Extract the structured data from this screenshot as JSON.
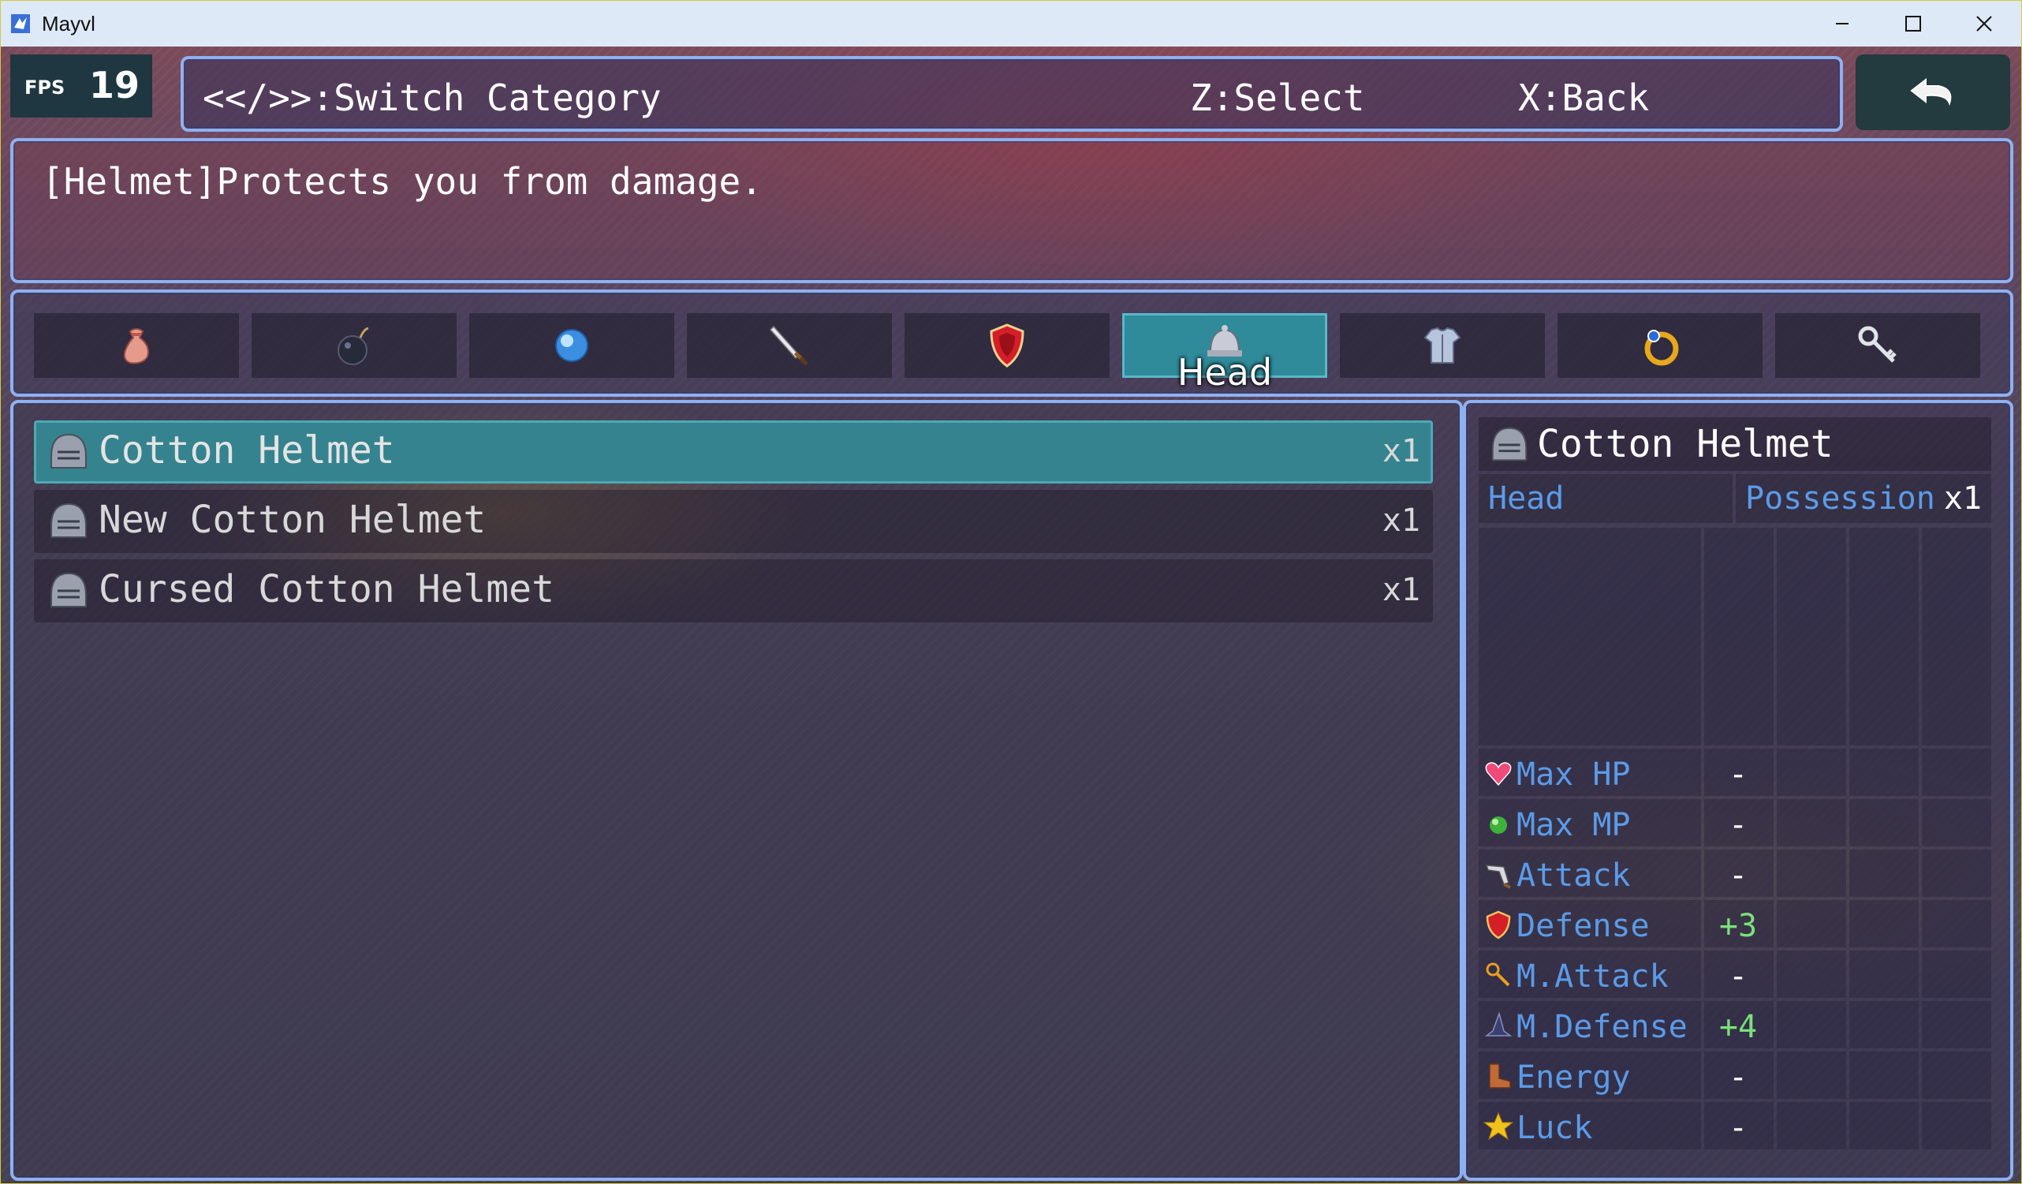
{
  "window": {
    "title": "Mayvl"
  },
  "fps": {
    "label": "FPS",
    "value": "19"
  },
  "help": {
    "switch": "<</>>:Switch Category",
    "select": "Z:Select",
    "back": "X:Back"
  },
  "description": "[Helmet]Protects you from damage.",
  "categories": [
    {
      "icon": "potion-bag-icon"
    },
    {
      "icon": "bomb-icon"
    },
    {
      "icon": "orb-icon"
    },
    {
      "icon": "sword-icon"
    },
    {
      "icon": "shield-icon"
    },
    {
      "icon": "helmet-icon",
      "label": "Head",
      "selected": true
    },
    {
      "icon": "armor-icon"
    },
    {
      "icon": "ring-icon"
    },
    {
      "icon": "key-icon"
    }
  ],
  "items": [
    {
      "name": "Cotton Helmet",
      "qty": "x1",
      "selected": true
    },
    {
      "name": "New Cotton Helmet",
      "qty": "x1"
    },
    {
      "name": "Cursed Cotton Helmet",
      "qty": "x1"
    }
  ],
  "detail": {
    "name": "Cotton Helmet",
    "slot": "Head",
    "possession_label": "Possession",
    "possession_value": "x1",
    "stats": [
      {
        "name": "Max HP",
        "icon": "heart-icon",
        "value": "-"
      },
      {
        "name": "Max MP",
        "icon": "green-orb-icon",
        "value": "-"
      },
      {
        "name": "Attack",
        "icon": "attack-icon",
        "value": "-"
      },
      {
        "name": "Defense",
        "icon": "defense-icon",
        "value": "+3"
      },
      {
        "name": "M.Attack",
        "icon": "wand-icon",
        "value": "-"
      },
      {
        "name": "M.Defense",
        "icon": "witch-hat-icon",
        "value": "+4"
      },
      {
        "name": "Energy",
        "icon": "boots-icon",
        "value": "-"
      },
      {
        "name": "Luck",
        "icon": "star-icon",
        "value": "-"
      }
    ]
  },
  "colors": {
    "highlight": "#35838f",
    "frame": "#8fb0f0",
    "stat_label": "#5b9be8",
    "positive": "#7be07a"
  }
}
